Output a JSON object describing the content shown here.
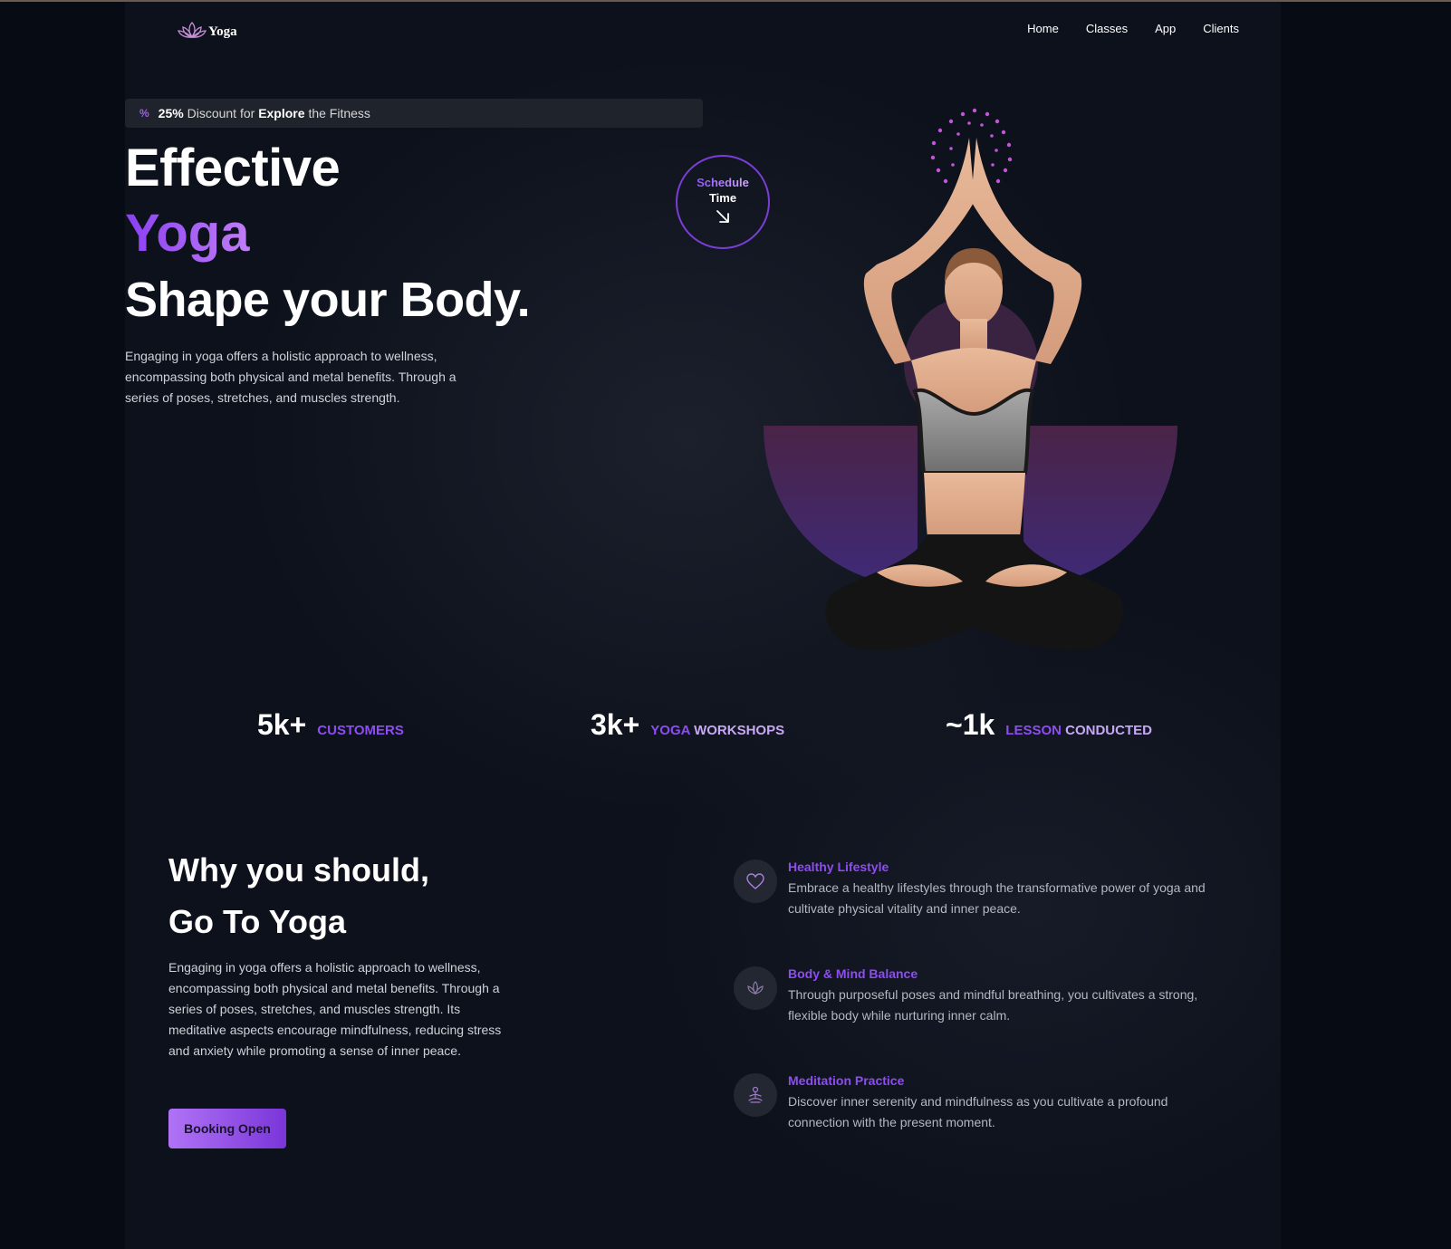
{
  "brand": {
    "name": "Yoga"
  },
  "nav": {
    "items": [
      "Home",
      "Classes",
      "App",
      "Clients"
    ]
  },
  "promo": {
    "percent": "25%",
    "text1": "Discount for",
    "bold": "Explore",
    "text2": "the Fitness"
  },
  "hero": {
    "line1": "Effective",
    "line2": "Yoga",
    "line3": "Shape your Body.",
    "description": "Engaging in yoga offers a holistic approach to wellness, encompassing both physical and metal benefits. Through a series of poses, stretches, and muscles strength."
  },
  "schedule": {
    "line1": "Schedule",
    "line2": "Time"
  },
  "stats": [
    {
      "num": "5k+",
      "label_a": "CUSTOMERS",
      "label_b": ""
    },
    {
      "num": "3k+",
      "label_a": "YOGA",
      "label_b": "WORKSHOPS"
    },
    {
      "num": "~1k",
      "label_a": "LESSON",
      "label_b": "CONDUCTED"
    }
  ],
  "why": {
    "title1": "Why you should,",
    "title2": "Go To Yoga",
    "description": "Engaging in yoga offers a holistic approach to wellness, encompassing both physical and metal benefits. Through a series of poses, stretches, and muscles strength. Its meditative aspects encourage mindfulness, reducing stress and anxiety while promoting a sense of inner peace.",
    "button": "Booking Open"
  },
  "features": [
    {
      "icon": "heart-icon",
      "title": "Healthy Lifestyle",
      "desc": "Embrace a healthy lifestyles through the transformative power of yoga and cultivate physical vitality and inner peace."
    },
    {
      "icon": "lotus-icon",
      "title": "Body & Mind Balance",
      "desc": "Through purposeful poses and mindful breathing, you cultivates a strong, flexible body while nurturing inner calm."
    },
    {
      "icon": "meditation-icon",
      "title": "Meditation Practice",
      "desc": "Discover inner serenity and mindfulness as you cultivate a profound connection with the present moment."
    }
  ],
  "colors": {
    "accent": "#8d4df0",
    "background": "#0d111b",
    "outer": "#070b14"
  }
}
